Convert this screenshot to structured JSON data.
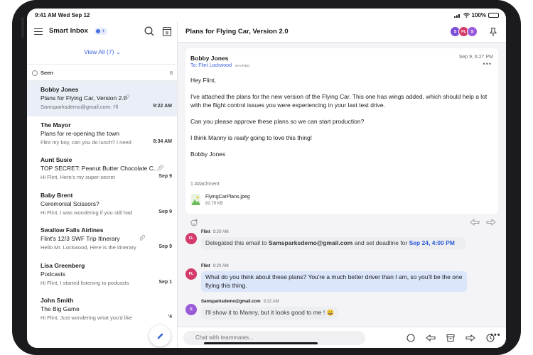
{
  "status_bar": {
    "time": "9:41 AM  Wed Sep 12",
    "battery": "100%"
  },
  "sidebar": {
    "title": "Smart Inbox",
    "view_all": "View All (7) ⌄",
    "seen_label": "Seen",
    "seen_count": "8",
    "messages": [
      {
        "sender": "Bobby Jones",
        "subject": "Plans for Flying Car, Version 2.0",
        "preview": "Samsparksdemo@gmail.com: I'll",
        "time": "9:22 AM",
        "selected": true,
        "has_attachment": true
      },
      {
        "sender": "The Mayor",
        "subject": "Plans for re-opening the town",
        "preview": "Flint my boy, can you do lunch? I need",
        "time": "8:34 AM",
        "selected": false,
        "has_attachment": false
      },
      {
        "sender": "Aunt Susie",
        "subject": "TOP SECRET: Peanut Butter Chocolate C...",
        "preview": "Hi Flint, Here's my super-secret",
        "time": "Sep 9",
        "selected": false,
        "has_attachment": true
      },
      {
        "sender": "Baby Brent",
        "subject": "Ceremonial Scissors?",
        "preview": "Hi Flint, I was wondering if you still had",
        "time": "Sep 9",
        "selected": false,
        "has_attachment": false
      },
      {
        "sender": "Swallow Falls Airlines",
        "subject": "Flint's 12/3 SWF Trip Itinerary",
        "preview": "Hello Mr. Lockwood, Here is the itinerary",
        "time": "Sep 9",
        "selected": false,
        "has_attachment": true
      },
      {
        "sender": "Lisa Greenberg",
        "subject": "Podcasts",
        "preview": "Hi Flint, I started listening to podcasts",
        "time": "Sep 1",
        "selected": false,
        "has_attachment": false
      },
      {
        "sender": "John Smith",
        "subject": "The Big Game",
        "preview": "Hi Flint, Just wondering what you'd like",
        "time": "'4",
        "selected": false,
        "has_attachment": false
      }
    ]
  },
  "thread": {
    "title": "Plans for Flying Car, Version 2.0",
    "participants": [
      {
        "initials": "S",
        "color": "#7b4fd6"
      },
      {
        "initials": "FL",
        "color": "#d43a6a"
      },
      {
        "initials": "S",
        "color": "#9b5bd9"
      }
    ]
  },
  "email": {
    "from": "Bobby Jones",
    "to": "To: Flint Lockwood",
    "shared_badge": "SHARED",
    "date": "Sep 9, 6:27 PM",
    "greeting": "Hey Flint,",
    "paragraph1": "I've attached the plans for the new version of the Flying Car. This one has wings added, which should help a lot with the flight control issues you were experiencing in your last test drive.",
    "paragraph2": "Can you please approve these plans so we can start production?",
    "p3_before": "I think Manny is ",
    "p3_emph": "really",
    "p3_after": " going to love this thing!",
    "signature": "Bobby Jones",
    "attachment_count": "1 Attachment",
    "attachment_name": "FlyingCarPlans.jpeg",
    "attachment_size": "82.79 KB"
  },
  "chat": [
    {
      "initials": "FL",
      "avatar_color": "#d43a6a",
      "name": "Flint",
      "time": "9:20 AM",
      "text_before": "Delegated this email to ",
      "text_bold": "Samsparksdemo@gmail.com",
      "text_mid": " and set deadline for ",
      "text_highlight": "Sep 24, 4:00 PM"
    },
    {
      "initials": "FL",
      "avatar_color": "#d43a6a",
      "name": "Flint",
      "time": "9:20 AM",
      "text": "What do you think about these plans? You're a much better driver than I am, so you'll be the one flying this thing."
    },
    {
      "initials": "S",
      "avatar_color": "#9b5bd9",
      "name": "Samsparksdemo@gmail.com",
      "time": "9:22 AM",
      "text": "I'll show it to Manny, but it looks good to me ! 😀"
    }
  ],
  "chat_input": {
    "placeholder": "Chat with teammates..."
  },
  "colors": {
    "accent": "#3b64d8",
    "selected_row": "#e9eef7",
    "bubble_blue": "#dbe6fb"
  }
}
